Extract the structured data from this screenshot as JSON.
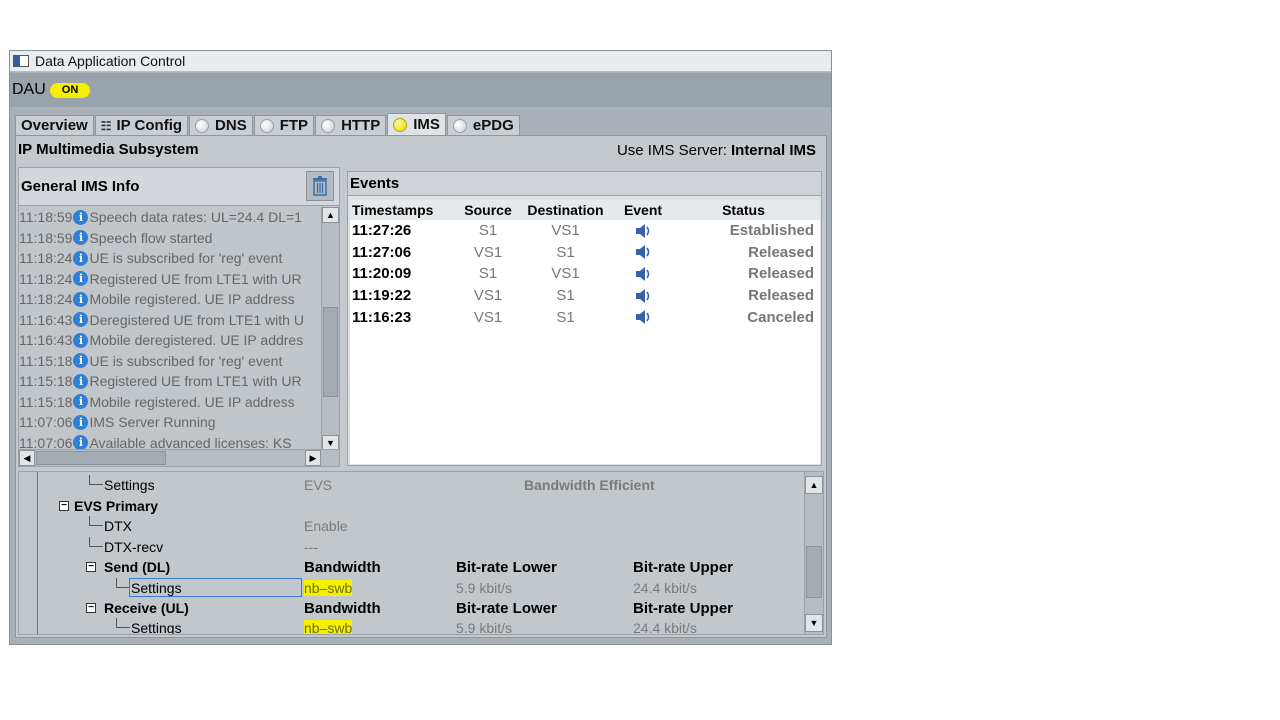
{
  "window": {
    "title": "Data Application Control"
  },
  "dau": {
    "label": "DAU",
    "status": "ON"
  },
  "tabs": [
    {
      "label": "Overview"
    },
    {
      "label": "IP Config"
    },
    {
      "label": "DNS"
    },
    {
      "label": "FTP"
    },
    {
      "label": "HTTP"
    },
    {
      "label": "IMS"
    },
    {
      "label": "ePDG"
    }
  ],
  "ims": {
    "heading": "IP Multimedia Subsystem",
    "server_label": "Use IMS Server:",
    "server_value": "Internal IMS"
  },
  "general": {
    "title": "General IMS Info",
    "log": [
      {
        "time": "11:18:59",
        "text": "Speech data rates: UL=24.4 DL=1"
      },
      {
        "time": "11:18:59",
        "text": "Speech flow started"
      },
      {
        "time": "11:18:24",
        "text": "UE is subscribed for 'reg' event"
      },
      {
        "time": "11:18:24",
        "text": "Registered UE from LTE1 with UR"
      },
      {
        "time": "11:18:24",
        "text": "Mobile registered. UE IP address"
      },
      {
        "time": "11:16:43",
        "text": "Deregistered UE from LTE1 with U"
      },
      {
        "time": "11:16:43",
        "text": "Mobile deregistered. UE IP addres"
      },
      {
        "time": "11:15:18",
        "text": "UE is subscribed for 'reg' event"
      },
      {
        "time": "11:15:18",
        "text": "Registered UE from LTE1 with UR"
      },
      {
        "time": "11:15:18",
        "text": "Mobile registered. UE IP address"
      },
      {
        "time": "11:07:06",
        "text": "IMS Server Running"
      },
      {
        "time": "11:07:06",
        "text": "Available advanced licenses: KS"
      }
    ]
  },
  "events": {
    "title": "Events",
    "columns": [
      "Timestamps",
      "Source",
      "Destination",
      "Event",
      "Status"
    ],
    "rows": [
      {
        "time": "11:27:26",
        "source": "S1",
        "destination": "VS1",
        "status": "Established"
      },
      {
        "time": "11:27:06",
        "source": "VS1",
        "destination": "S1",
        "status": "Released"
      },
      {
        "time": "11:20:09",
        "source": "S1",
        "destination": "VS1",
        "status": "Released"
      },
      {
        "time": "11:19:22",
        "source": "VS1",
        "destination": "S1",
        "status": "Released"
      },
      {
        "time": "11:16:23",
        "source": "VS1",
        "destination": "S1",
        "status": "Canceled"
      }
    ]
  },
  "settings_tree": {
    "settings_label": "Settings",
    "settings_codec": "EVS",
    "settings_mode": "Bandwidth Efficient",
    "evs_primary": "EVS Primary",
    "dtx": "DTX",
    "dtx_value": "Enable",
    "dtx_recv": "DTX-recv",
    "dtx_recv_value": "---",
    "send": "Send (DL)",
    "receive": "Receive (UL)",
    "col_bandwidth": "Bandwidth",
    "col_lower": "Bit-rate Lower",
    "col_upper": "Bit-rate Upper",
    "send_settings": {
      "label": "Settings",
      "bandwidth": "nb–swb",
      "lower": "5.9 kbit/s",
      "upper": "24.4 kbit/s"
    },
    "recv_settings": {
      "label": "Settings",
      "bandwidth": "nb–swb",
      "lower": "5.9 kbit/s",
      "upper": "24.4 kbit/s"
    }
  }
}
